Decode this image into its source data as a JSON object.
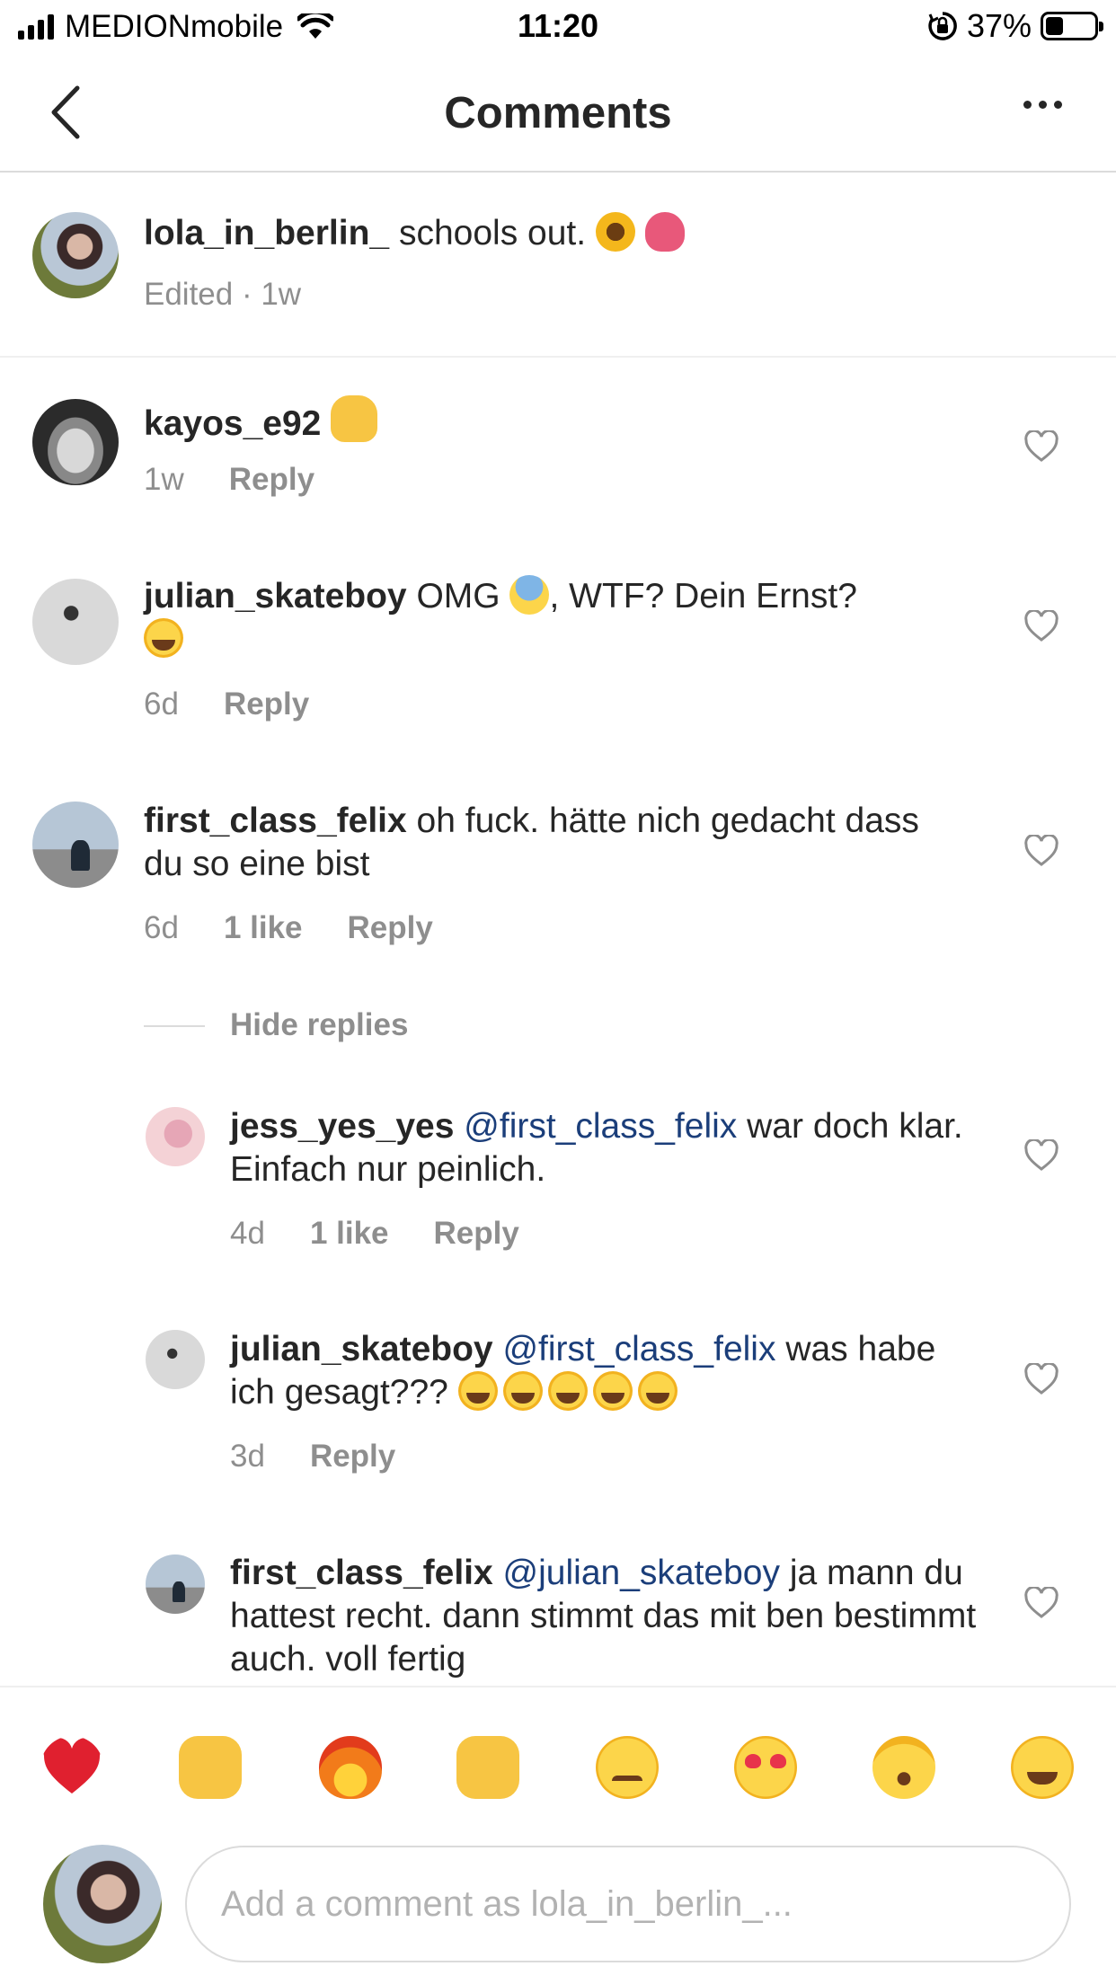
{
  "status_bar": {
    "carrier": "MEDIONmobile",
    "time": "11:20",
    "battery_percent": "37%",
    "battery_level": 0.37,
    "signal_bars": 4
  },
  "nav": {
    "title": "Comments",
    "back_icon": "chevron-left-icon",
    "more_icon": "more-horizontal-icon"
  },
  "caption": {
    "user": "lola_in_berlin_",
    "text": "schools out.",
    "emojis": [
      "sunflower",
      "tulip"
    ],
    "meta": "Edited · 1w"
  },
  "comments": [
    {
      "user": "kayos_e92",
      "text": "",
      "emojis": [
        "thumbs-up"
      ],
      "time": "1w",
      "reply_label": "Reply"
    },
    {
      "user": "julian_skateboy",
      "text_before": "OMG",
      "text_after": ", WTF? Dein Ernst?",
      "time": "6d",
      "reply_label": "Reply"
    },
    {
      "user": "first_class_felix",
      "text": "oh fuck. hätte nich gedacht dass du so eine bist",
      "time": "6d",
      "likes": "1 like",
      "reply_label": "Reply"
    }
  ],
  "hide_replies_label": "Hide replies",
  "replies": [
    {
      "user": "jess_yes_yes",
      "mention": "@first_class_felix",
      "text": "war doch klar. Einfach nur peinlich.",
      "time": "4d",
      "likes": "1 like",
      "reply_label": "Reply"
    },
    {
      "user": "julian_skateboy",
      "mention": "@first_class_felix",
      "text": "was habe ich gesagt???",
      "laugh_count": 5,
      "time": "3d",
      "reply_label": "Reply"
    },
    {
      "user": "first_class_felix",
      "mention": "@julian_skateboy",
      "text": "ja mann du hattest recht. dann stimmt das mit ben bestimmt auch. voll fertig"
    }
  ],
  "quick_emojis": [
    "red-heart",
    "raising-hands",
    "fire",
    "clapping-hands",
    "crying-face",
    "heart-eyes",
    "surprised-face",
    "tears-of-joy"
  ],
  "input": {
    "placeholder": "Add a comment as lola_in_berlin_..."
  },
  "colors": {
    "mention": "#1b3e7a",
    "secondary_text": "#8e8e8e",
    "divider": "#dbdbdb"
  }
}
